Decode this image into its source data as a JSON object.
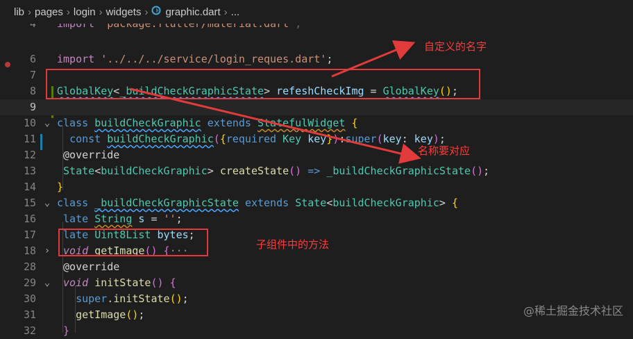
{
  "breadcrumb": {
    "items": [
      "lib",
      "pages",
      "login",
      "widgets",
      "graphic.dart",
      "..."
    ]
  },
  "code_lines": [
    {
      "num": "4",
      "text": "import 'package:flutter/material.dart';"
    },
    {
      "num": "6",
      "text": "import '../../../service/login_reques.dart';"
    },
    {
      "num": "7",
      "text": ""
    },
    {
      "num": "8",
      "text": "GlobalKey<_buildCheckGraphicState> refeshCheckImg = GlobalKey();"
    },
    {
      "num": "9",
      "text": ""
    },
    {
      "num": "10",
      "text": "class buildCheckGraphic extends StatefulWidget {"
    },
    {
      "num": "11",
      "text": "  const buildCheckGraphic({required Key key}):super(key: key);"
    },
    {
      "num": "12",
      "text": "  @override"
    },
    {
      "num": "13",
      "text": "  State<buildCheckGraphic> createState() => _buildCheckGraphicState();"
    },
    {
      "num": "14",
      "text": "}"
    },
    {
      "num": "15",
      "text": "class _buildCheckGraphicState extends State<buildCheckGraphic> {"
    },
    {
      "num": "16",
      "text": "  late String s = '';"
    },
    {
      "num": "17",
      "text": "  late Uint8List bytes;"
    },
    {
      "num": "18",
      "text": "  void getImage() {···"
    },
    {
      "num": "28",
      "text": "  @override"
    },
    {
      "num": "29",
      "text": "  void initState() {"
    },
    {
      "num": "30",
      "text": "    super.initState();"
    },
    {
      "num": "31",
      "text": "    getImage();"
    },
    {
      "num": "32",
      "text": "  }"
    }
  ],
  "annotations": {
    "custom_name": "自定义的名字",
    "name_match": "名称要对应",
    "child_method": "子组件中的方法"
  },
  "watermark": "@稀土掘金技术社区",
  "colors": {
    "background": "#1e1e1e",
    "annotation_red": "#e23b3b",
    "keyword": "#569cd6",
    "type": "#4ec9b0",
    "function": "#dcdcaa",
    "string": "#ce9178"
  }
}
